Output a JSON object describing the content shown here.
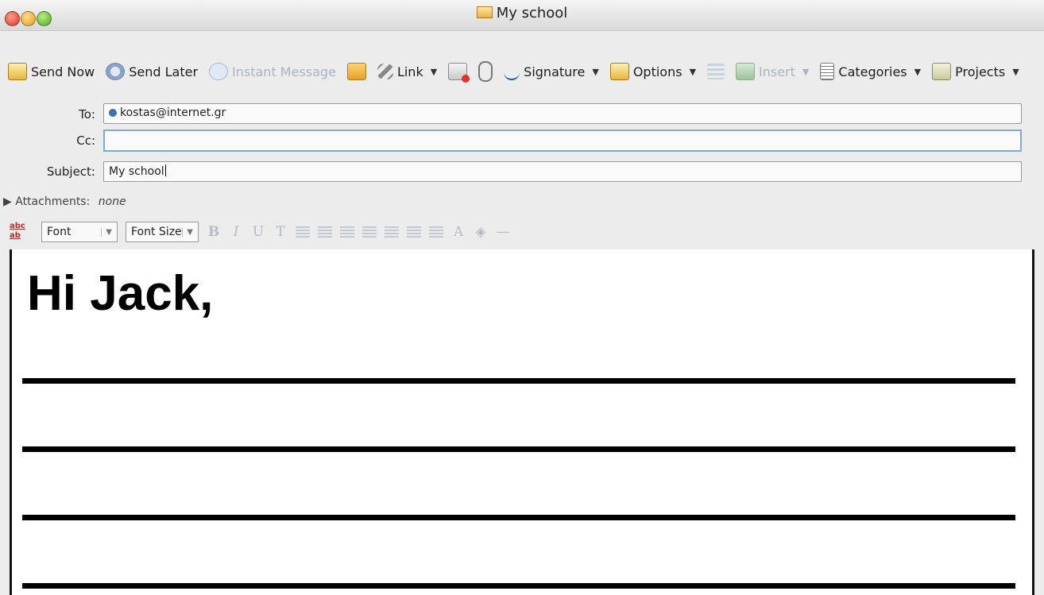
{
  "window": {
    "title": "My school"
  },
  "toolbar": {
    "items": [
      {
        "label": "Send Now",
        "icon": "send-now-icon",
        "enabled": true,
        "dropdown": false
      },
      {
        "label": "Send Later",
        "icon": "send-later-icon",
        "enabled": true,
        "dropdown": false
      },
      {
        "label": "Instant Message",
        "icon": "instant-message-icon",
        "enabled": false,
        "dropdown": false
      },
      {
        "label": "",
        "icon": "address-book-icon",
        "enabled": true,
        "dropdown": false
      },
      {
        "label": "Link",
        "icon": "link-icon",
        "enabled": true,
        "dropdown": true
      },
      {
        "label": "",
        "icon": "delete-icon",
        "enabled": true,
        "dropdown": false
      },
      {
        "label": "",
        "icon": "attachment-icon",
        "enabled": true,
        "dropdown": false
      },
      {
        "label": "Signature",
        "icon": "signature-icon",
        "enabled": true,
        "dropdown": true
      },
      {
        "label": "Options",
        "icon": "options-icon",
        "enabled": true,
        "dropdown": true
      },
      {
        "label": "",
        "icon": "arrows-icon",
        "enabled": false,
        "dropdown": false
      },
      {
        "label": "Insert",
        "icon": "insert-icon",
        "enabled": false,
        "dropdown": true
      },
      {
        "label": "Categories",
        "icon": "categories-icon",
        "enabled": true,
        "dropdown": true
      },
      {
        "label": "Projects",
        "icon": "projects-icon",
        "enabled": true,
        "dropdown": true
      }
    ]
  },
  "header": {
    "to_label": "To:",
    "to_value": "kostas@internet.gr",
    "cc_label": "Cc:",
    "cc_value": "",
    "subject_label": "Subject:",
    "subject_value": "My school",
    "attachments_label": "Attachments:",
    "attachments_value": "none"
  },
  "format": {
    "font_label": "Font",
    "size_label": "Font Size",
    "bold": "B",
    "italic": "I",
    "underline": "U",
    "strike": "T"
  },
  "body": {
    "greeting": "Hi Jack,"
  }
}
